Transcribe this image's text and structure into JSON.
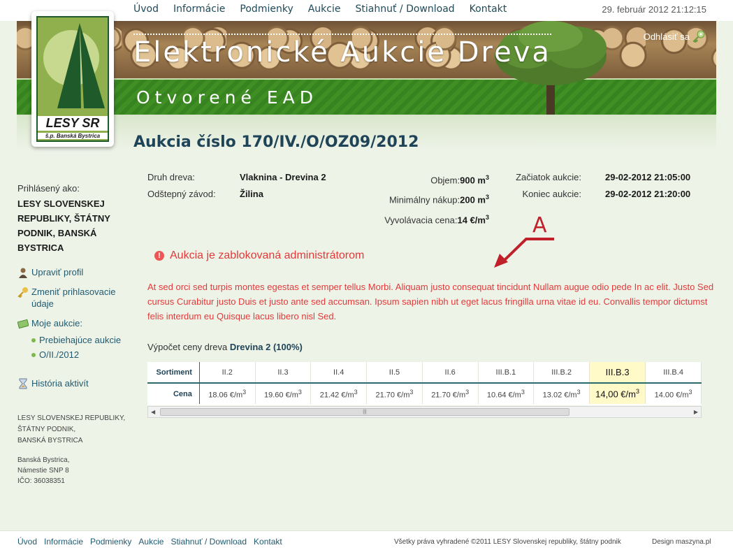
{
  "topnav": [
    "Úvod",
    "Informácie",
    "Podmienky",
    "Aukcie",
    "Stiahnuť / Download",
    "Kontakt"
  ],
  "datetime": "29. február 2012 21:12:15",
  "banner": {
    "title": "Elektronické Aukcie Dreva",
    "subtitle": "Otvorené EAD",
    "logout": "Odhlásiť sa"
  },
  "logo": {
    "name": "LESY SR",
    "sub": "š.p. Banská Bystrica"
  },
  "page_title": "Aukcia číslo 170/IV./O/OZ09/2012",
  "sidebar": {
    "logged_label": "Prihlásený ako:",
    "user": "LESY SLOVENSKEJ REPUBLIKY, ŠTÁTNY PODNIK, BANSKÁ BYSTRICA",
    "edit_profile": "Upraviť profil",
    "change_login": "Zmeniť prihlasovacie údaje",
    "my_auctions": "Moje aukcie:",
    "sub_items": [
      "Prebiehajúce aukcie",
      "O/II./2012"
    ],
    "history": "História aktivít",
    "org": [
      "LESY SLOVENSKEJ REPUBLIKY,",
      "ŠTÁTNY PODNIK,",
      "BANSKÁ BYSTRICA"
    ],
    "address": [
      "Banská Bystrica,",
      "Námestie SNP 8",
      "IČO: 36038351"
    ]
  },
  "info": {
    "wood_type_label": "Druh dreva:",
    "wood_type": "Vlaknina - Drevina 2",
    "plant_label": "Odštepný závod:",
    "plant": "Žilina",
    "volume_label": "Objem:",
    "volume": "900 m",
    "min_buy_label": "Minimálny nákup:",
    "min_buy": "200 m",
    "start_price_label": "Vyvolávacia cena:",
    "start_price": "14 €/m",
    "start_label": "Začiatok aukcie:",
    "start": "29-02-2012 21:05:00",
    "end_label": "Koniec aukcie:",
    "end": "29-02-2012 21:20:00"
  },
  "alert": {
    "title": "Aukcia je zablokovaná administrátorom",
    "annotation": "A",
    "body": "At sed orci sed turpis montes egestas et semper tellus Morbi. Aliquam justo consequat tincidunt Nullam augue odio pede In ac elit. Justo Sed cursus Curabitur justo Duis et justo ante sed accumsan. Ipsum sapien nibh ut eget lacus fringilla urna vitae id eu. Convallis tempor dictumst felis interdum eu Quisque lacus libero nisl Sed."
  },
  "calc": {
    "label": "Výpočet ceny dreva",
    "value": "Drevina 2 (100%)"
  },
  "table": {
    "row1_head": "Sortiment",
    "row2_head": "Cena",
    "columns": [
      "II.2",
      "II.3",
      "II.4",
      "II.5",
      "II.6",
      "III.B.1",
      "III.B.2",
      "III.B.3",
      "III.B.4"
    ],
    "prices": [
      "18.06 €/m",
      "19.60 €/m",
      "21.42 €/m",
      "21.70 €/m",
      "21.70 €/m",
      "10.64 €/m",
      "13.02 €/m",
      "14,00 €/m",
      "14.00 €/m"
    ],
    "highlight_index": 7
  },
  "footer": {
    "nav": [
      "Úvod",
      "Informácie",
      "Podmienky",
      "Aukcie",
      "Stiahnuť / Download",
      "Kontakt"
    ],
    "copyright": "Všetky práva vyhradené ©2011 LESY Slovenskej republiky, štátny podnik",
    "design": "Design maszyna.pl"
  }
}
